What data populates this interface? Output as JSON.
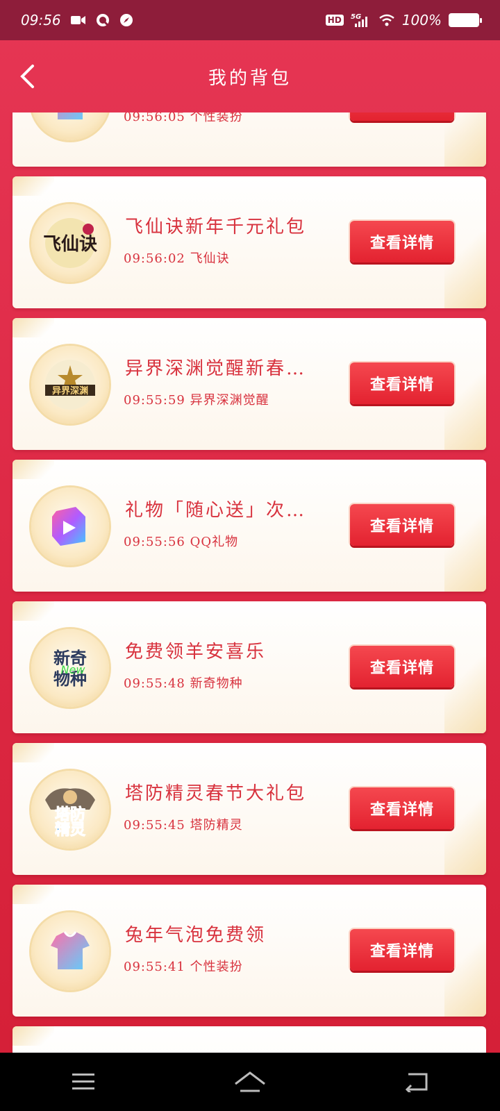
{
  "status_bar": {
    "time": "09:56",
    "hd": "HD",
    "network": "5G",
    "battery": "100%"
  },
  "header": {
    "title": "我的背包"
  },
  "detail_label": "查看详情",
  "items": [
    {
      "name": "",
      "time": "09:56:05",
      "source": "个性装扮",
      "meta": "09:56:05 个性装扮",
      "icon": "shirt-icon"
    },
    {
      "name": "飞仙诀新年千元礼包",
      "time": "09:56:02",
      "source": "飞仙诀",
      "meta": "09:56:02 飞仙诀",
      "icon": "feixianjue-logo"
    },
    {
      "name": "异界深渊觉醒新春…",
      "time": "09:55:59",
      "source": "异界深渊觉醒",
      "meta": "09:55:59 异界深渊觉醒",
      "icon": "abyss-logo"
    },
    {
      "name": "礼物「随心送」次…",
      "time": "09:55:56",
      "source": "QQ礼物",
      "meta": "09:55:56 QQ礼物",
      "icon": "qq-gift-logo"
    },
    {
      "name": "免费领羊安喜乐",
      "time": "09:55:48",
      "source": "新奇物种",
      "meta": "09:55:48 新奇物种",
      "icon": "xinqi-logo"
    },
    {
      "name": "塔防精灵春节大礼包",
      "time": "09:55:45",
      "source": "塔防精灵",
      "meta": "09:55:45 塔防精灵",
      "icon": "tafang-logo"
    },
    {
      "name": "兔年气泡免费领",
      "time": "09:55:41",
      "source": "个性装扮",
      "meta": "09:55:41 个性装扮",
      "icon": "shirt-icon"
    }
  ],
  "icon_text": {
    "feixianjue": "飞仙诀",
    "abyss": "异界深渊",
    "xinqi_top": "新奇",
    "xinqi_bottom": "物种",
    "xinqi_new": "New",
    "tafang_top": "塔防",
    "tafang_bottom": "精灵"
  },
  "colors": {
    "accent_red": "#d8323e",
    "button_red": "#e32230",
    "status_bar": "#8e1d3a",
    "background": "#de2a46"
  }
}
